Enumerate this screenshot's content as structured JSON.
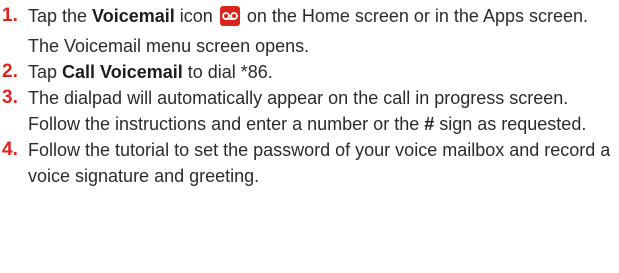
{
  "steps": [
    {
      "number": "1.",
      "pre": "Tap the ",
      "bold": "Voicemail",
      "mid": " icon",
      "icon": "voicemail-icon",
      "post": " on the Home screen or in the Apps screen.",
      "note": "The Voicemail menu screen opens."
    },
    {
      "number": "2.",
      "pre": "Tap ",
      "bold": "Call Voicemail",
      "post": " to dial *86."
    },
    {
      "number": "3.",
      "pre": "The dialpad will automatically appear on the call in progress screen. Follow the instructions and enter a number or the ",
      "bold": "#",
      "post": " sign as requested."
    },
    {
      "number": "4.",
      "text": "Follow the tutorial to set the password of your voice mailbox and record a voice signature and greeting."
    }
  ],
  "colors": {
    "accent": "#e2231a",
    "icon_bg": "#d9261c",
    "text": "#2b2b2b"
  }
}
